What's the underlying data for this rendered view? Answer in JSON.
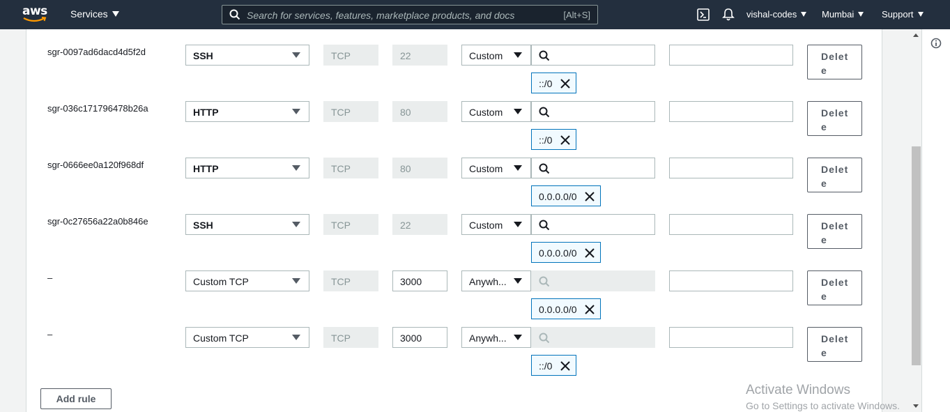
{
  "header": {
    "logo_text": "aws",
    "services_label": "Services",
    "search_placeholder": "Search for services, features, marketplace products, and docs",
    "search_shortcut": "[Alt+S]",
    "account": "vishal-codes",
    "region": "Mumbai",
    "support": "Support"
  },
  "rules": [
    {
      "id": "sgr-0097ad6dacd4d5f2d",
      "type": "SSH",
      "type_bold": true,
      "protocol": "TCP",
      "port": "22",
      "port_editable": false,
      "source_type": "Custom",
      "source_search_disabled": false,
      "cidr": "::/0",
      "delete_label": "Delete"
    },
    {
      "id": "sgr-036c171796478b26a",
      "type": "HTTP",
      "type_bold": true,
      "protocol": "TCP",
      "port": "80",
      "port_editable": false,
      "source_type": "Custom",
      "source_search_disabled": false,
      "cidr": "::/0",
      "delete_label": "Delete"
    },
    {
      "id": "sgr-0666ee0a120f968df",
      "type": "HTTP",
      "type_bold": true,
      "protocol": "TCP",
      "port": "80",
      "port_editable": false,
      "source_type": "Custom",
      "source_search_disabled": false,
      "cidr": "0.0.0.0/0",
      "delete_label": "Delete"
    },
    {
      "id": "sgr-0c27656a22a0b846e",
      "type": "SSH",
      "type_bold": true,
      "protocol": "TCP",
      "port": "22",
      "port_editable": false,
      "source_type": "Custom",
      "source_search_disabled": false,
      "cidr": "0.0.0.0/0",
      "delete_label": "Delete"
    },
    {
      "id": "–",
      "type": "Custom TCP",
      "type_bold": false,
      "protocol": "TCP",
      "port": "3000",
      "port_editable": true,
      "source_type": "Anywh...",
      "source_search_disabled": true,
      "cidr": "0.0.0.0/0",
      "delete_label": "Delete"
    },
    {
      "id": "–",
      "type": "Custom TCP",
      "type_bold": false,
      "protocol": "TCP",
      "port": "3000",
      "port_editable": true,
      "source_type": "Anywh...",
      "source_search_disabled": true,
      "cidr": "::/0",
      "delete_label": "Delete"
    }
  ],
  "add_rule_label": "Add rule",
  "watermark": {
    "title": "Activate Windows",
    "subtitle": "Go to Settings to activate Windows."
  },
  "colors": {
    "topbar": "#232f3e",
    "token_border": "#0073bb",
    "token_bg": "#f1faff"
  }
}
